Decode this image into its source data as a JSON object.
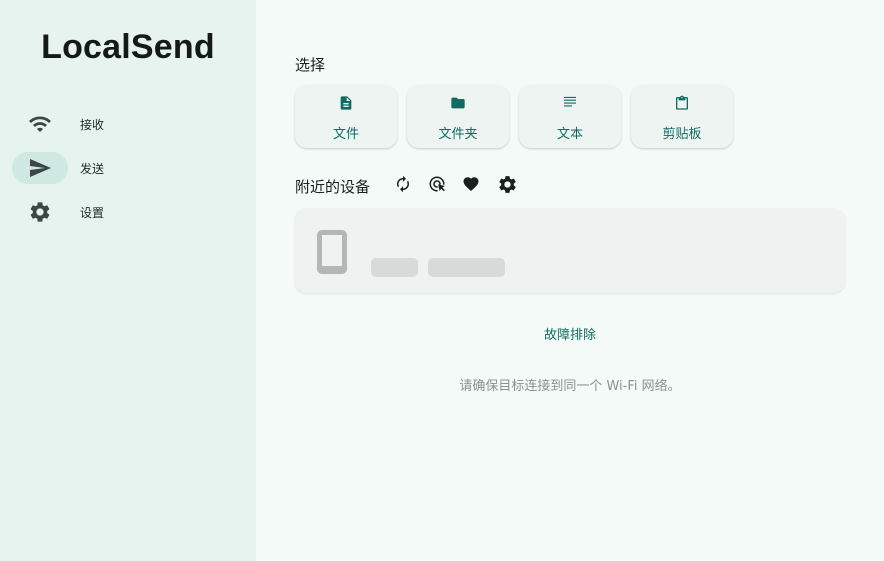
{
  "app": {
    "title": "LocalSend"
  },
  "sidebar": {
    "items": [
      {
        "label": "接收",
        "icon": "wifi-icon",
        "active": false
      },
      {
        "label": "发送",
        "icon": "send-icon",
        "active": true
      },
      {
        "label": "设置",
        "icon": "gear-icon",
        "active": false
      }
    ]
  },
  "selection": {
    "title": "选择",
    "buttons": [
      {
        "label": "文件",
        "icon": "file-icon"
      },
      {
        "label": "文件夹",
        "icon": "folder-icon"
      },
      {
        "label": "文本",
        "icon": "text-lines-icon"
      },
      {
        "label": "剪贴板",
        "icon": "clipboard-icon"
      }
    ]
  },
  "nearby": {
    "title": "附近的设备",
    "tools": [
      "refresh-icon",
      "target-scan-icon",
      "heart-icon",
      "gear-icon"
    ],
    "device_placeholder_icon": "phone-icon"
  },
  "troubleshoot": {
    "label": "故障排除"
  },
  "hint": {
    "text": "请确保目标连接到同一个 Wi-Fi 网络。"
  },
  "colors": {
    "accent": "#116b61",
    "sidebar_bg": "#e7f3ef",
    "main_bg": "#f3faf7",
    "active_pill": "#cfe8e1"
  }
}
